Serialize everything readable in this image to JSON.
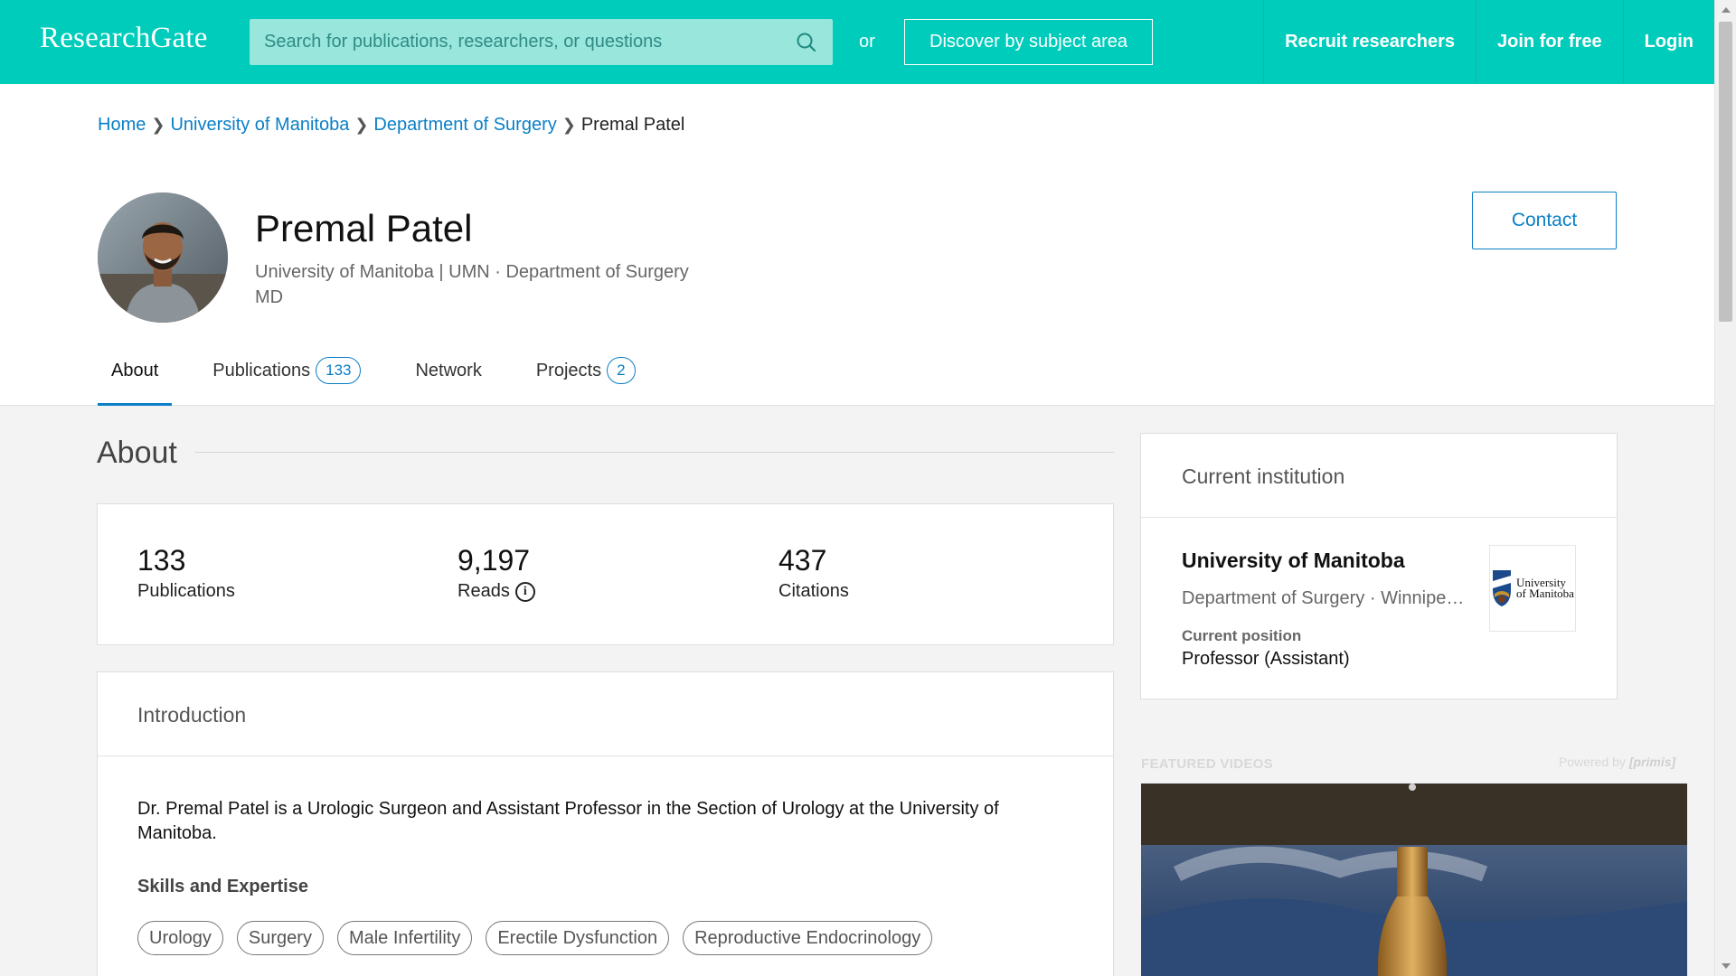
{
  "header": {
    "logo": "ResearchGate",
    "search_placeholder": "Search for publications, researchers, or questions",
    "or_label": "or",
    "discover_label": "Discover by subject area",
    "recruit_label": "Recruit researchers",
    "join_label": "Join for free",
    "login_label": "Login",
    "brand_color": "#00ccbb"
  },
  "breadcrumb": [
    {
      "label": "Home"
    },
    {
      "label": "University of Manitoba"
    },
    {
      "label": "Department of Surgery"
    },
    {
      "label": "Premal Patel"
    }
  ],
  "profile": {
    "name": "Premal Patel",
    "affiliation": "University of Manitoba | UMN · Department of Surgery",
    "degree": "MD",
    "contact_label": "Contact"
  },
  "tabs": [
    {
      "label": "About",
      "count": ""
    },
    {
      "label": "Publications",
      "count": "133"
    },
    {
      "label": "Network",
      "count": ""
    },
    {
      "label": "Projects",
      "count": "2"
    }
  ],
  "about": {
    "title": "About",
    "stats": [
      {
        "value": "133",
        "label": "Publications"
      },
      {
        "value": "9,197",
        "label": "Reads"
      },
      {
        "value": "437",
        "label": "Citations"
      }
    ],
    "intro_title": "Introduction",
    "intro_text": "Dr. Premal Patel is a Urologic Surgeon and Assistant Professor in the Section of Urology at the University of Manitoba.",
    "skills_title": "Skills and Expertise",
    "skills": [
      "Urology",
      "Surgery",
      "Male Infertility",
      "Erectile Dysfunction",
      "Reproductive Endocrinology"
    ]
  },
  "institution": {
    "title": "Current institution",
    "name": "University of Manitoba",
    "department": "Department of Surgery · Winnipeg, Manitoba",
    "position_label": "Current position",
    "position": "Professor (Assistant)",
    "logo_text_1": "University",
    "logo_text_2": "of Manitoba"
  },
  "featured": {
    "label": "FEATURED VIDEOS",
    "powered_prefix": "Powered by",
    "powered_brand": "[primis]"
  }
}
